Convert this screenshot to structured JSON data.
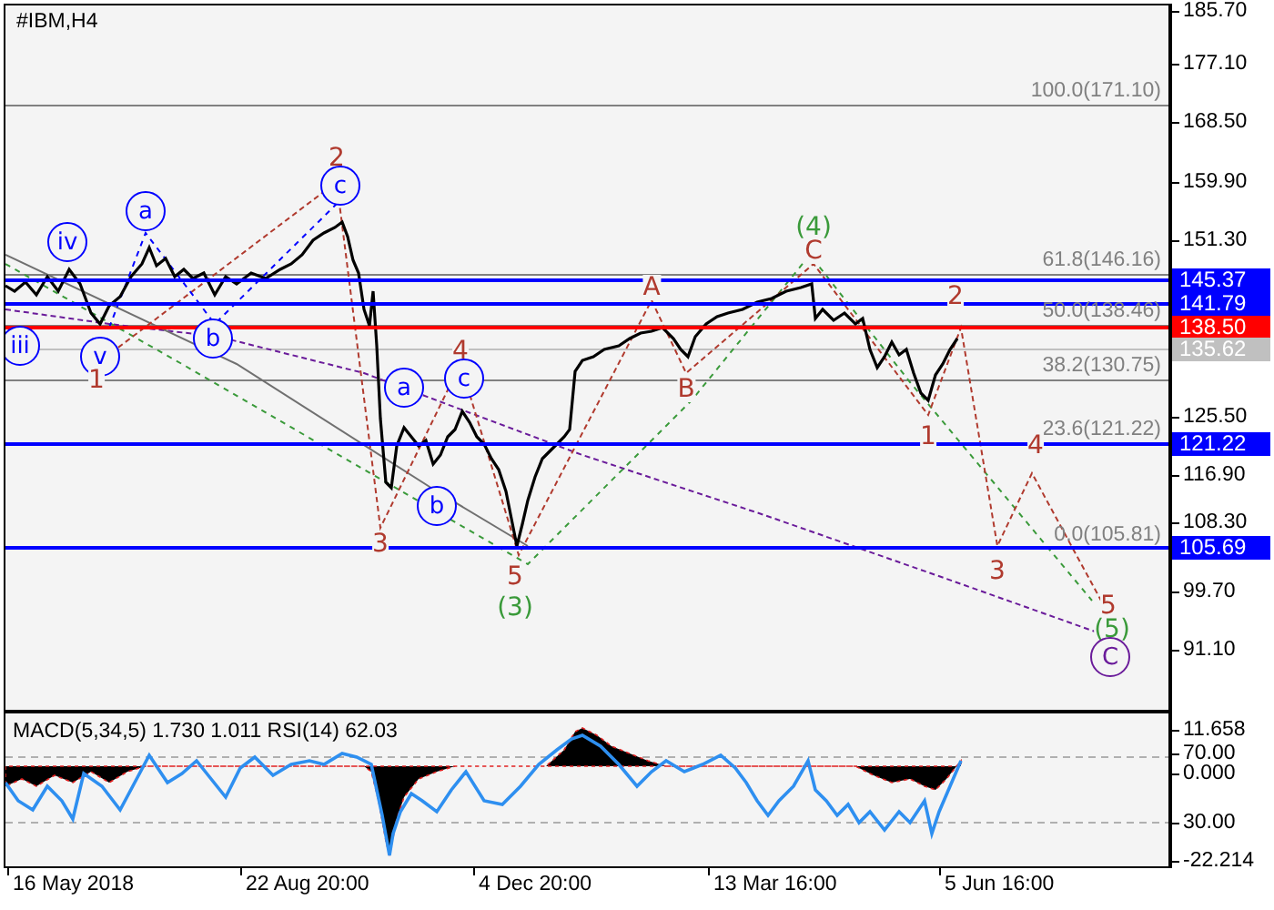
{
  "chart": {
    "symbol": "#IBM,H4",
    "price_axis": [
      "185.70",
      "177.10",
      "168.50",
      "159.90",
      "151.30",
      "125.50",
      "116.90",
      "108.30",
      "99.70",
      "91.10"
    ],
    "levels": [
      {
        "label": "145.37",
        "color": "#0000ff"
      },
      {
        "label": "141.79",
        "color": "#0000ff"
      },
      {
        "label": "138.50",
        "color": "#ff0000"
      },
      {
        "label": "135.62",
        "color": "#c0c0c0"
      },
      {
        "label": "121.22",
        "color": "#0000ff"
      },
      {
        "label": "105.69",
        "color": "#0000ff"
      }
    ],
    "fib_levels": [
      "100.0(171.10)",
      "61.8(146.16)",
      "50.0(138.46)",
      "38.2(130.75)",
      "23.6(121.22)",
      "0.0(105.81)"
    ],
    "wave_labels": [
      {
        "text": "iii",
        "kind": "circled",
        "color": "#0000ff"
      },
      {
        "text": "iv",
        "kind": "circled",
        "color": "#0000ff"
      },
      {
        "text": "a",
        "kind": "circled",
        "color": "#0000ff"
      },
      {
        "text": "v",
        "kind": "circled",
        "color": "#0000ff"
      },
      {
        "text": "1",
        "kind": "plain",
        "color": "#b03a2e"
      },
      {
        "text": "b",
        "kind": "circled",
        "color": "#0000ff"
      },
      {
        "text": "2",
        "kind": "plain",
        "color": "#b03a2e"
      },
      {
        "text": "c",
        "kind": "circled",
        "color": "#0000ff"
      },
      {
        "text": "a",
        "kind": "circled",
        "color": "#0000ff"
      },
      {
        "text": "4",
        "kind": "plain",
        "color": "#b03a2e"
      },
      {
        "text": "c",
        "kind": "circled",
        "color": "#0000ff"
      },
      {
        "text": "b",
        "kind": "circled",
        "color": "#0000ff"
      },
      {
        "text": "3",
        "kind": "plain",
        "color": "#b03a2e"
      },
      {
        "text": "5",
        "kind": "plain",
        "color": "#b03a2e"
      },
      {
        "text": "(3)",
        "kind": "plain",
        "color": "#3a9a3a"
      },
      {
        "text": "A",
        "kind": "plain",
        "color": "#b03a2e"
      },
      {
        "text": "B",
        "kind": "plain",
        "color": "#b03a2e"
      },
      {
        "text": "(4)",
        "kind": "plain",
        "color": "#3a9a3a"
      },
      {
        "text": "C",
        "kind": "plain",
        "color": "#b03a2e"
      },
      {
        "text": "2",
        "kind": "plain",
        "color": "#b03a2e"
      },
      {
        "text": "1",
        "kind": "plain",
        "color": "#b03a2e"
      },
      {
        "text": "4",
        "kind": "plain",
        "color": "#b03a2e"
      },
      {
        "text": "3",
        "kind": "plain",
        "color": "#b03a2e"
      },
      {
        "text": "5",
        "kind": "plain",
        "color": "#b03a2e"
      },
      {
        "text": "(5)",
        "kind": "plain",
        "color": "#3a9a3a"
      },
      {
        "text": "C",
        "kind": "circled",
        "color": "#6a1b9a"
      }
    ]
  },
  "indicator": {
    "legend": "MACD(5,34,5) 1.730 1.011 RSI(14) 62.03",
    "axis": [
      "11.658",
      "70.00",
      "0.000",
      "30.00",
      "-22.214"
    ]
  },
  "time_axis": [
    "16 May 2018",
    "22 Aug 20:00",
    "4 Dec 20:00",
    "13 Mar 16:00",
    "5 Jun 16:00"
  ]
}
